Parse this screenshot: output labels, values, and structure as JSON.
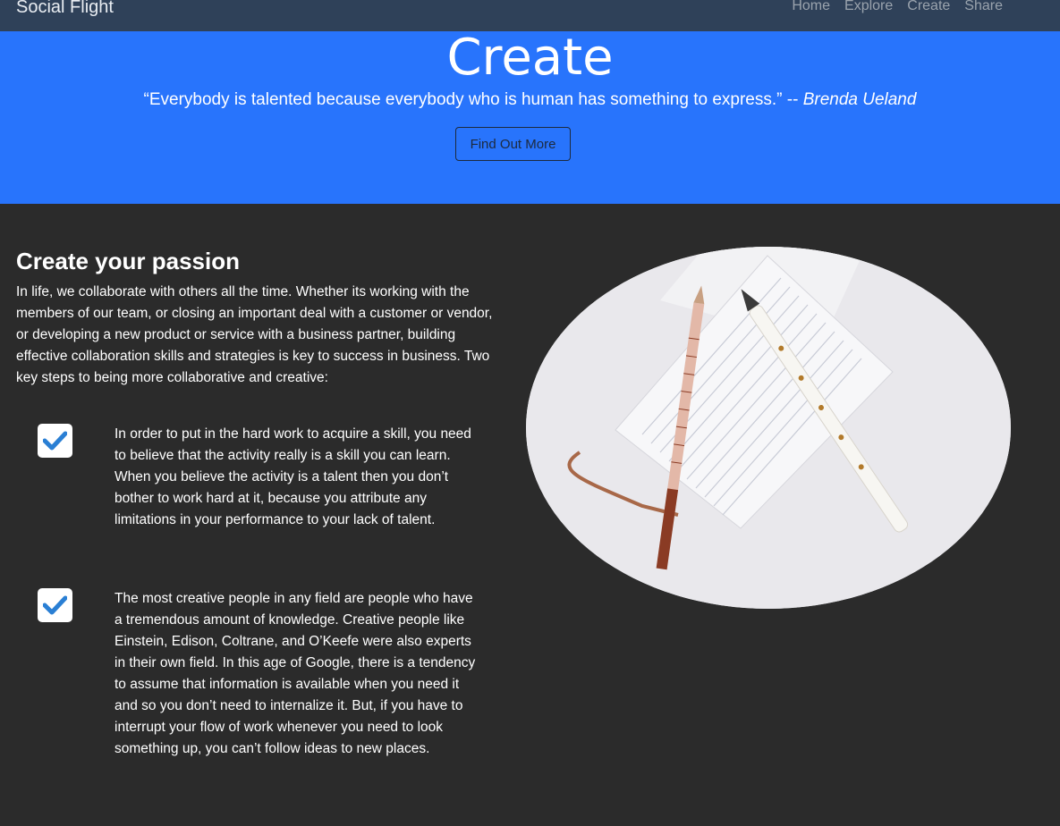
{
  "navbar": {
    "brand": "Social Flight",
    "links": [
      "Home",
      "Explore",
      "Create",
      "Share"
    ]
  },
  "hero": {
    "title": "Create",
    "quote": "“Everybody is talented because everybody who is human has something to express.” --",
    "author": "Brenda Ueland",
    "button_label": "Find Out More"
  },
  "main": {
    "heading": "Create your passion",
    "intro": "In life, we collaborate with others all the time. Whether its working with the members of our team, or closing an important deal with a customer or vendor, or developing a new product or service with a business partner, building effective collaboration skills and strategies is key to success in business. Two key steps to being more collaborative and creative:",
    "features": [
      {
        "icon": "checkbox-checked-icon",
        "text": "In order to put in the hard work to acquire a skill, you need to believe that the activity really is a skill you can learn. When you believe the activity is a talent then you don’t bother to work hard at it, because you attribute any limitations in your performance to your lack of talent."
      },
      {
        "icon": "checkbox-checked-icon",
        "text": "The most creative people in any field are people who have a tremendous amount of knowledge. Creative people like Einstein, Edison, Coltrane, and O’Keefe were also experts in their own field. In this age of Google, there is a tendency to assume that information is available when you need it and so you don’t need to internalize it. But, if you have to interrupt your flow of work whenever you need to look something up, you can’t follow ideas to new places."
      }
    ]
  },
  "colors": {
    "navbar": "#2f4159",
    "hero": "#2874fc",
    "body": "#2b2b2b",
    "check": "#2a7fd4"
  }
}
